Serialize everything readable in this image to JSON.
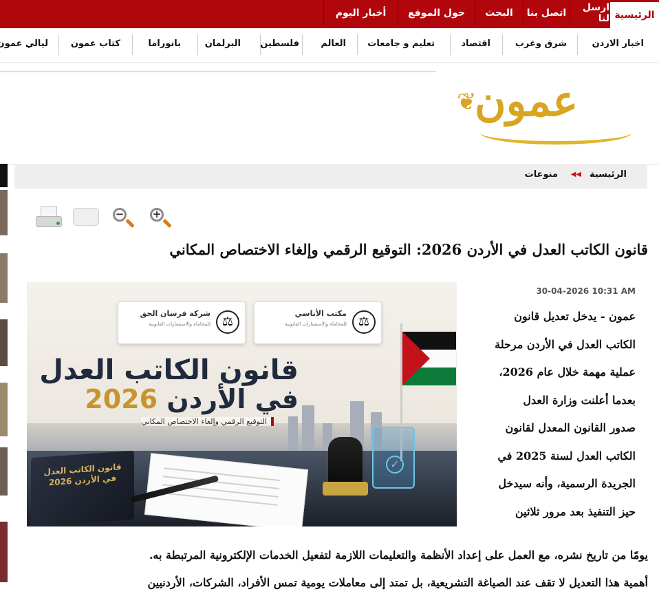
{
  "topbar": {
    "tabs": [
      "الرئيسية",
      "ارسل لنا",
      "اتصل بنا",
      "البحث",
      "حول الموقع",
      "أخبار اليوم"
    ],
    "accent": "#b1060c"
  },
  "nav": {
    "items": [
      "اخبار الاردن",
      "شرق وغرب",
      "اقتصاد",
      "تعليم و جامعات",
      "العالم",
      "فلسطين",
      "البرلمان",
      "بانوراما",
      "كتاب عمون",
      "ليالي عمون"
    ]
  },
  "logo": {
    "text": "عمون"
  },
  "breadcrumb": {
    "home": "الرئيسية",
    "category": "منوعات"
  },
  "tools": {
    "icons": [
      "printer-icon",
      "comment-icon",
      "zoom-out-icon",
      "zoom-in-icon"
    ]
  },
  "article": {
    "headline": "قانون الكاتب العدل في الأردن 2026: التوقيع الرقمي وإلغاء الاختصاص المكاني",
    "date": "30-04-2026 10:31 AM",
    "narrow_lines": [
      "عمون - يدخل تعديل قانون",
      "الكاتب العدل في الأردن مرحلة",
      "عملية مهمة خلال عام 2026،",
      "بعدما أعلنت وزارة العدل",
      "صدور القانون المعدل لقانون",
      "الكاتب العدل لسنة 2025 في",
      "الجريدة الرسمية، وأنه سيدخل",
      "حيز التنفيذ بعد مرور ثلاثين"
    ],
    "wide_lines": [
      "يومًا من تاريخ نشره، مع العمل على إعداد الأنظمة والتعليمات اللازمة لتفعيل الخدمات الإلكترونية المرتبطة به.",
      "أهمية هذا التعديل لا تقف عند الصياغة التشريعية، بل تمتد إلى معاملات يومية تمس الأفراد، الشركات، الأردنيين"
    ]
  },
  "hero": {
    "card_right_title": "مكتب الأناسي",
    "card_right_sub": "للمحاماة والاستشارات القانونية",
    "card_left_title": "شركة فرسان الحق",
    "card_left_sub": "للمحاماة والاستشارات القانونية",
    "big_line1": "قانون الكاتب العدل",
    "big_line2_ar": "في الأردن",
    "big_line2_year": "2026",
    "subtitle": "التوقيع الرقمي وإلغاء الاختصاص المكاني",
    "book_text": "قانون الكاتب العدل في الأردن 2026"
  }
}
